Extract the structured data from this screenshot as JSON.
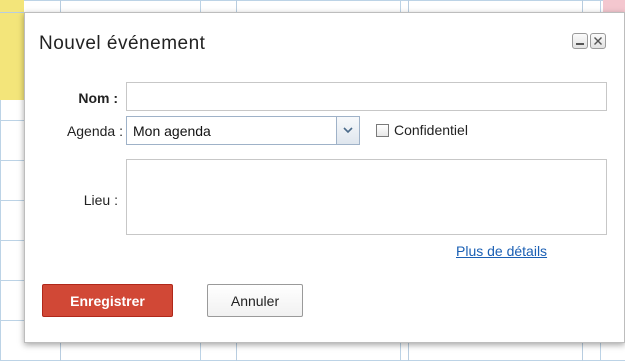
{
  "dialog": {
    "title": "Nouvel événement",
    "minimize_icon": "minimize-icon",
    "close_icon": "close-icon"
  },
  "form": {
    "name_label": "Nom :",
    "name_value": "",
    "calendar_label": "Agenda :",
    "calendar_selected": "Mon agenda",
    "private_label": "Confidentiel",
    "private_checked": false,
    "location_label": "Lieu :",
    "location_value": "",
    "more_details_link": "Plus de détails"
  },
  "actions": {
    "save_label": "Enregistrer",
    "cancel_label": "Annuler"
  },
  "colors": {
    "save_button": "#d14836",
    "link": "#1a5fb4",
    "calendar_yellow": "#f3e57a",
    "calendar_pink": "#f4c7cf",
    "grid_line": "#b8cde0"
  }
}
